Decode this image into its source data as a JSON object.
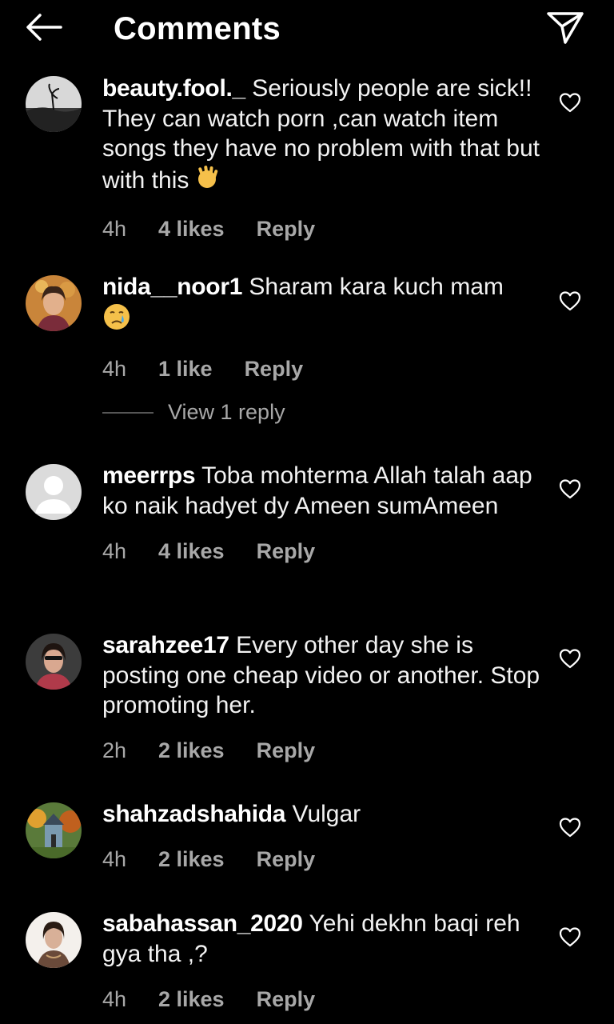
{
  "header": {
    "title": "Comments",
    "back_icon": "arrow-left-icon",
    "send_icon": "paper-plane-icon"
  },
  "colors": {
    "background": "#000000",
    "text": "#ffffff",
    "meta": "#a8a8a8"
  },
  "comments": [
    {
      "username": "beauty.fool._",
      "text": "Seriously people are sick!! They can watch porn ,can watch item songs they  have no problem with that but with this",
      "emoji": "waving-hand-emoji",
      "time": "4h",
      "likes": "4 likes",
      "reply": "Reply"
    },
    {
      "username": "nida__noor1",
      "text": "Sharam kara kuch mam",
      "emoji": "crying-face-emoji",
      "time": "4h",
      "likes": "1 like",
      "reply": "Reply",
      "view_replies": "View 1 reply"
    },
    {
      "username": "meerrps",
      "text": "Toba mohterma Allah talah aap ko naik hadyet dy Ameen sumAmeen",
      "time": "4h",
      "likes": "4 likes",
      "reply": "Reply"
    },
    {
      "username": "sarahzee17",
      "text": "Every other day she is posting one cheap video or another. Stop promoting her.",
      "time": "2h",
      "likes": "2 likes",
      "reply": "Reply"
    },
    {
      "username": "shahzadshahida",
      "text": "Vulgar",
      "time": "4h",
      "likes": "2 likes",
      "reply": "Reply"
    },
    {
      "username": "sabahassan_2020",
      "text": "Yehi dekhn baqi reh gya tha ,?",
      "time": "4h",
      "likes": "2 likes",
      "reply": "Reply"
    }
  ]
}
